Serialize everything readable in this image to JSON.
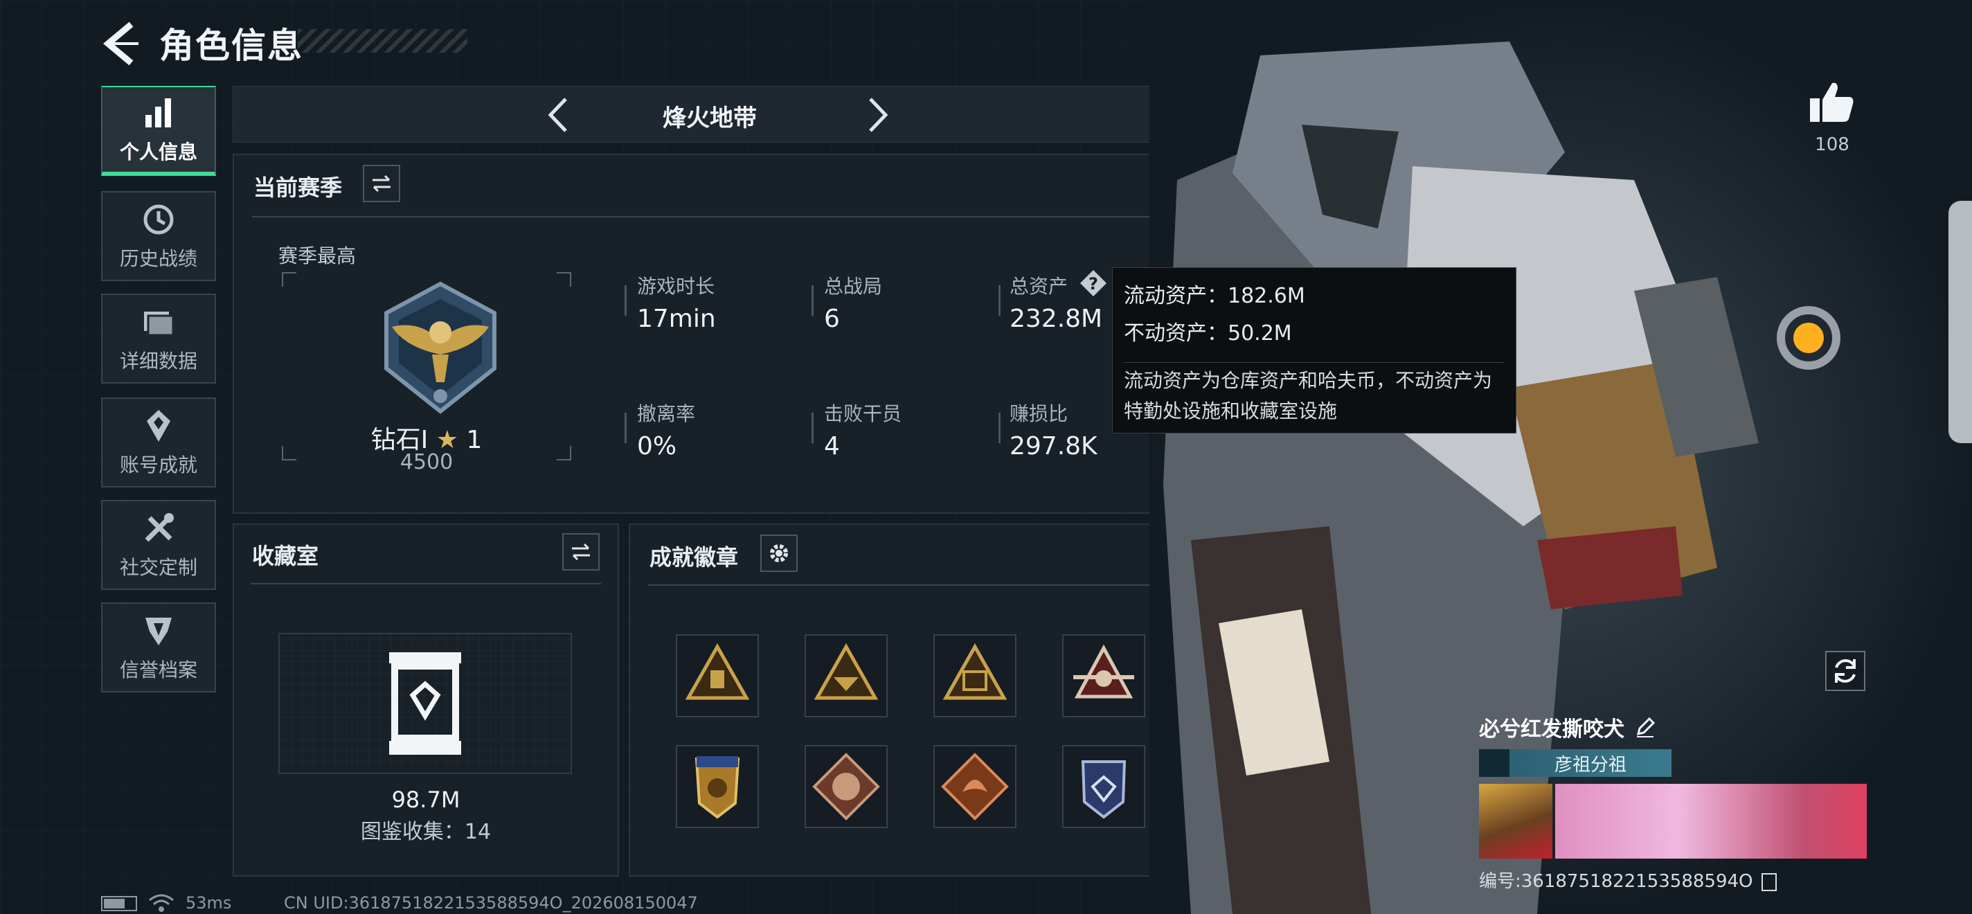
{
  "header": {
    "title": "角色信息"
  },
  "nav": {
    "items": [
      {
        "label": "个人信息",
        "icon": "bar-chart-icon",
        "active": true
      },
      {
        "label": "历史战绩",
        "icon": "history-icon",
        "active": false
      },
      {
        "label": "详细数据",
        "icon": "folder-icon",
        "active": false
      },
      {
        "label": "账号成就",
        "icon": "medal-icon",
        "active": false
      },
      {
        "label": "社交定制",
        "icon": "tools-icon",
        "active": false
      },
      {
        "label": "信誉档案",
        "icon": "shield-icon",
        "active": false
      }
    ]
  },
  "mode": {
    "title": "烽火地带"
  },
  "season": {
    "title": "当前赛季",
    "best_label": "赛季最高",
    "rank_name": "钻石Ⅰ",
    "rank_stars": "1",
    "rank_points": "4500",
    "stats": [
      {
        "label": "游戏时长",
        "value": "17min"
      },
      {
        "label": "总战局",
        "value": "6"
      },
      {
        "label": "总资产",
        "value": "232.8M"
      },
      {
        "label": "撤离率",
        "value": "0%"
      },
      {
        "label": "击败干员",
        "value": "4"
      },
      {
        "label": "赚损比",
        "value": "297.8K"
      }
    ]
  },
  "tooltip": {
    "liquid": "流动资产：182.6M",
    "fixed": "不动资产：50.2M",
    "description": "流动资产为仓库资产和哈夫币，不动资产为特勤处设施和收藏室设施"
  },
  "collection": {
    "title": "收藏室",
    "value": "98.7M",
    "count_text": "图鉴收集：14"
  },
  "badges": {
    "title": "成就徽章",
    "items": [
      "badge-1",
      "badge-2",
      "badge-3",
      "badge-4",
      "badge-5",
      "badge-6",
      "badge-7",
      "badge-8"
    ]
  },
  "likes": {
    "count": "108"
  },
  "profile": {
    "name": "必兮红发撕咬犬",
    "team": "彦祖分祖",
    "id_text": "编号:3618751822153588594O"
  },
  "status": {
    "ping": "53ms",
    "uid": "CN UID:3618751822153588594O_202608150047"
  },
  "colors": {
    "accent": "#3ddc97",
    "gold": "#c8a24a",
    "panel": "#182028"
  }
}
